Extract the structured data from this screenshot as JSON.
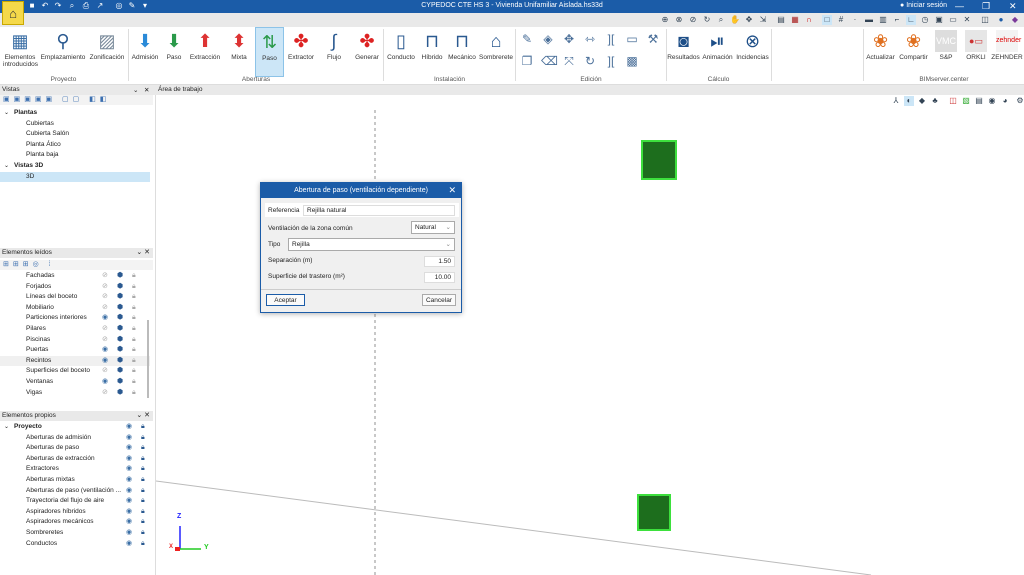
{
  "window": {
    "title": "CYPEDOC CTE HS 3 - Vivienda Unifamiliar Aislada.hs33d",
    "signin": "Iniciar sesión",
    "minimize": "—",
    "maximize": "❐",
    "close": "✕"
  },
  "ribbon": {
    "groups": {
      "proyecto": "Proyecto",
      "aberturas": "Aberturas",
      "instalacion": "Instalación",
      "edicion": "Edición",
      "calculo": "Cálculo",
      "bimserver": "BIMserver.center"
    },
    "buttons": {
      "elementos": "Elementos introducidos",
      "emplazamiento": "Emplazamiento",
      "zonificacion": "Zonificación",
      "admision": "Admisión",
      "paso": "Paso",
      "extraccion": "Extracción",
      "mixta": "Mixta",
      "paso2": "Paso",
      "extractor": "Extractor",
      "flujo": "Flujo",
      "generar": "Generar",
      "conducto": "Conducto",
      "hibrido": "Híbrido",
      "mecanico": "Mecánico",
      "sombrerete": "Sombrerete",
      "resultados": "Resultados",
      "animacion": "Animación",
      "incidencias": "Incidencias",
      "actualizar": "Actualizar",
      "compartir": "Compartir",
      "sp": "S&P",
      "orkli": "ORKLI",
      "zehnder": "ZEHNDER"
    }
  },
  "panels": {
    "vistas": {
      "title": "Vistas",
      "items": [
        {
          "label": "Plantas",
          "top": true
        },
        {
          "label": "Cubiertas"
        },
        {
          "label": "Cubierta Salón"
        },
        {
          "label": "Planta Ático"
        },
        {
          "label": "Planta baja"
        },
        {
          "label": "Vistas 3D",
          "top": true
        },
        {
          "label": "3D",
          "selected": true
        }
      ]
    },
    "leidos": {
      "title": "Elementos leídos",
      "items": [
        {
          "label": "Fachadas",
          "visible": false
        },
        {
          "label": "Forjados",
          "visible": false
        },
        {
          "label": "Líneas del boceto",
          "visible": false
        },
        {
          "label": "Mobiliario",
          "visible": false
        },
        {
          "label": "Particiones interiores",
          "visible": true
        },
        {
          "label": "Pilares",
          "visible": false
        },
        {
          "label": "Piscinas",
          "visible": false
        },
        {
          "label": "Puertas",
          "visible": true
        },
        {
          "label": "Recintos",
          "visible": true
        },
        {
          "label": "Superficies del boceto",
          "visible": false
        },
        {
          "label": "Ventanas",
          "visible": true
        },
        {
          "label": "Vigas",
          "visible": false
        }
      ]
    },
    "propios": {
      "title": "Elementos propios",
      "items": [
        {
          "label": "Proyecto",
          "top": true
        },
        {
          "label": "Aberturas de admisión"
        },
        {
          "label": "Aberturas de paso"
        },
        {
          "label": "Aberturas de extracción"
        },
        {
          "label": "Extractores"
        },
        {
          "label": "Aberturas mixtas"
        },
        {
          "label": "Aberturas de paso (ventilación ..."
        },
        {
          "label": "Trayectoria del flujo de aire"
        },
        {
          "label": "Aspiradores híbridos"
        },
        {
          "label": "Aspiradores mecánicos"
        },
        {
          "label": "Sombreretes"
        },
        {
          "label": "Conductos"
        }
      ]
    }
  },
  "workarea": {
    "title": "Área de trabajo",
    "axes": {
      "z": "Z",
      "y": "Y",
      "x": "X"
    }
  },
  "dialog": {
    "title": "Abertura de paso (ventilación dependiente)",
    "referencia_label": "Referencia",
    "referencia_value": "Rejilla natural",
    "ventilacion_label": "Ventilación de la zona común",
    "ventilacion_value": "Natural",
    "tipo_label": "Tipo",
    "tipo_value": "Rejilla",
    "separacion_label": "Separación (m)",
    "separacion_value": "1.50",
    "superficie_label": "Superficie del trastero (m²)",
    "superficie_value": "10.00",
    "accept": "Aceptar",
    "cancel": "Cancelar"
  },
  "colors": {
    "titlebar": "#1b5ca8",
    "selection": "#cce6f7",
    "grille": "#2fbf2f"
  }
}
